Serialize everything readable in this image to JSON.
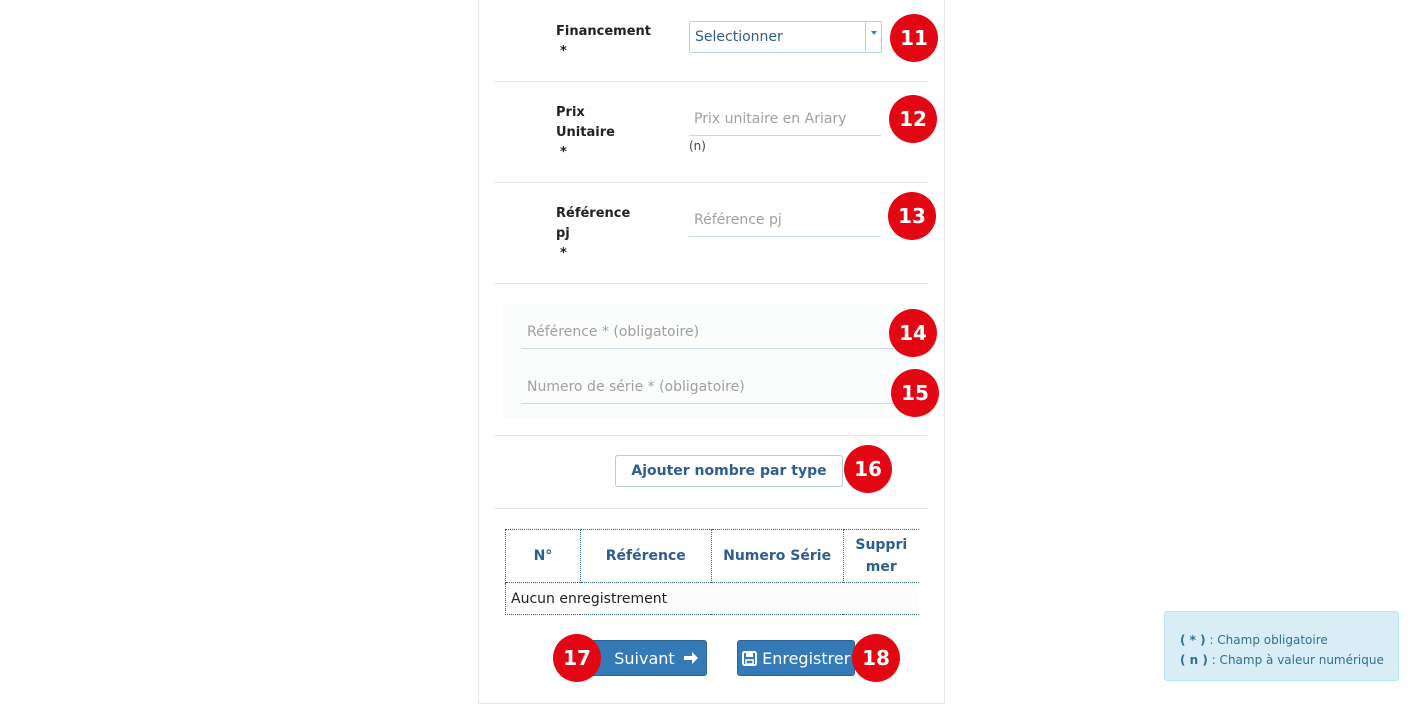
{
  "form": {
    "financement": {
      "label": "Financement",
      "required_mark": "*",
      "select_value": "Selectionner",
      "badge": "11"
    },
    "prix_unitaire": {
      "label_line1": "Prix",
      "label_line2": "Unitaire",
      "required_mark": "*",
      "placeholder": "Prix unitaire en Ariary",
      "hint": "(n)",
      "badge": "12"
    },
    "reference_pj": {
      "label_line1": "Référence",
      "label_line2": "pj",
      "required_mark": "*",
      "placeholder": "Référence pj",
      "badge": "13"
    },
    "reference": {
      "placeholder": "Référence * (obligatoire)",
      "badge": "14"
    },
    "numero_serie": {
      "placeholder": "Numero de série * (obligatoire)",
      "badge": "15"
    },
    "add_button": {
      "label": "Ajouter nombre par type",
      "badge": "16"
    }
  },
  "table": {
    "headers": [
      "N°",
      "Référence",
      "Numero Série",
      "Suppri mer"
    ],
    "empty_message": "Aucun enregistrement"
  },
  "actions": {
    "next": {
      "label": "Suivant",
      "icon": "arrow-right-icon",
      "badge": "17"
    },
    "save": {
      "label": "Enregistrer",
      "icon": "floppy-disk-icon",
      "badge": "18"
    }
  },
  "legend": {
    "required_key": "( * )",
    "required_text": ": Champ obligatoire",
    "numeric_key": "( n )",
    "numeric_text": ": Champ à valeur numérique"
  },
  "colors": {
    "accent": "#337ab7",
    "badge": "#e30613",
    "link": "#2e5d8f",
    "legend_bg": "#d9edf7"
  }
}
